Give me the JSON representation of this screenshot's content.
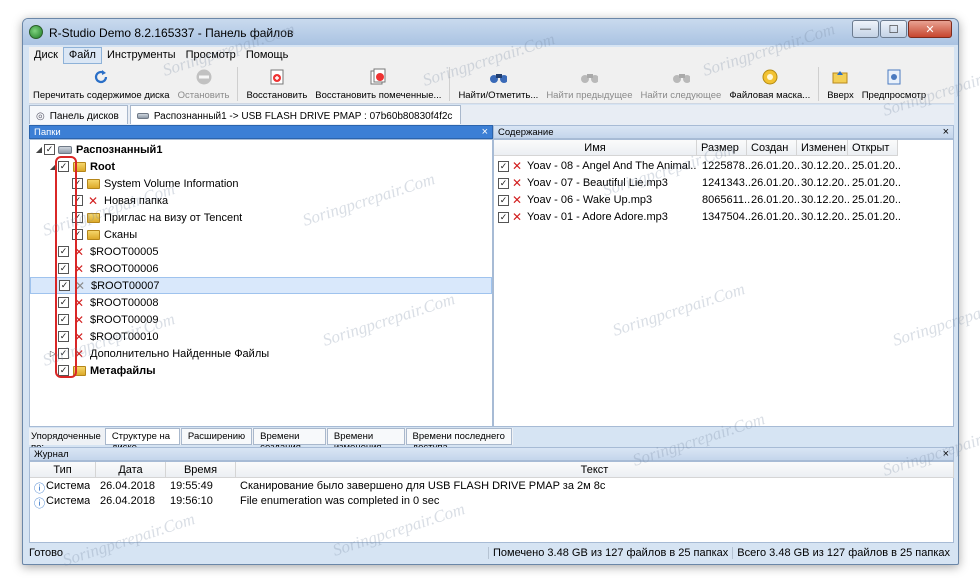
{
  "window": {
    "title": "R-Studio Demo 8.2.165337 - Панель файлов",
    "buttons": {
      "minimize": "—",
      "maximize": "☐",
      "close": "✕"
    }
  },
  "menu": [
    "Диск",
    "Файл",
    "Инструменты",
    "Просмотр",
    "Помощь"
  ],
  "toolbar": [
    {
      "label": "Перечитать содержимое диска",
      "icon": "refresh-icon",
      "enabled": true
    },
    {
      "label": "Остановить",
      "icon": "stop-icon",
      "enabled": false
    },
    {
      "label": "Восстановить",
      "icon": "recover-icon",
      "enabled": true
    },
    {
      "label": "Восстановить помеченные...",
      "icon": "recover-marked-icon",
      "enabled": true
    },
    {
      "label": "Найти/Отметить...",
      "icon": "find-icon",
      "enabled": true
    },
    {
      "label": "Найти предыдущее",
      "icon": "find-prev-icon",
      "enabled": false
    },
    {
      "label": "Найти следующее",
      "icon": "find-next-icon",
      "enabled": false
    },
    {
      "label": "Файловая маска...",
      "icon": "file-mask-icon",
      "enabled": true
    },
    {
      "label": "Вверх",
      "icon": "up-icon",
      "enabled": true
    },
    {
      "label": "Предпросмотр",
      "icon": "preview-icon",
      "enabled": true
    }
  ],
  "tabs": [
    {
      "label": "Панель дисков",
      "active": false
    },
    {
      "label": "Распознанный1 -> USB FLASH DRIVE PMAP : 07b60b80830f4f2c",
      "active": true
    }
  ],
  "folders_pane": {
    "header": "Папки",
    "close": "×",
    "tree": [
      {
        "label": "Распознанный1",
        "level": 0,
        "bold": true,
        "icon": "drive",
        "expander": "◢",
        "checked": true
      },
      {
        "label": "Root",
        "level": 1,
        "bold": true,
        "icon": "folder",
        "expander": "◢",
        "checked": true
      },
      {
        "label": "System Volume Information",
        "level": 2,
        "bold": false,
        "icon": "folder",
        "expander": "",
        "checked": true
      },
      {
        "label": "Новая папка",
        "level": 2,
        "bold": false,
        "icon": "deleted",
        "expander": "",
        "checked": true
      },
      {
        "label": "Приглас на визу от Tencent",
        "level": 2,
        "bold": false,
        "icon": "folder",
        "expander": "",
        "checked": true
      },
      {
        "label": "Сканы",
        "level": 2,
        "bold": false,
        "icon": "folder",
        "expander": "",
        "checked": true
      },
      {
        "label": "$ROOT00005",
        "level": 1,
        "bold": false,
        "icon": "deleted",
        "expander": "",
        "checked": true
      },
      {
        "label": "$ROOT00006",
        "level": 1,
        "bold": false,
        "icon": "deleted",
        "expander": "",
        "checked": true
      },
      {
        "label": "$ROOT00007",
        "level": 1,
        "bold": false,
        "icon": "deleted-gray",
        "expander": "",
        "checked": true,
        "selected": true
      },
      {
        "label": "$ROOT00008",
        "level": 1,
        "bold": false,
        "icon": "deleted",
        "expander": "",
        "checked": true
      },
      {
        "label": "$ROOT00009",
        "level": 1,
        "bold": false,
        "icon": "deleted",
        "expander": "",
        "checked": true
      },
      {
        "label": "$ROOT00010",
        "level": 1,
        "bold": false,
        "icon": "deleted",
        "expander": "",
        "checked": true
      },
      {
        "label": "Дополнительно Найденные Файлы",
        "level": 1,
        "bold": false,
        "icon": "deleted",
        "expander": "▷",
        "checked": true
      },
      {
        "label": "Метафайлы",
        "level": 1,
        "bold": true,
        "icon": "folder",
        "expander": "",
        "checked": true
      }
    ]
  },
  "contents_pane": {
    "header": "Содержание",
    "close": "×",
    "columns": [
      "Имя",
      "Размер",
      "Создан",
      "Изменен",
      "Открыт"
    ],
    "rows": [
      {
        "name": "Yoav - 08 - Angel And The Animal...",
        "size": "1225878...",
        "created": "26.01.20...",
        "modified": "30.12.20...",
        "opened": "25.01.20..."
      },
      {
        "name": "Yoav - 07 - Beautiful Lie.mp3",
        "size": "1241343...",
        "created": "26.01.20...",
        "modified": "30.12.20...",
        "opened": "25.01.20..."
      },
      {
        "name": "Yoav - 06 - Wake Up.mp3",
        "size": "8065611...",
        "created": "26.01.20...",
        "modified": "30.12.20...",
        "opened": "25.01.20..."
      },
      {
        "name": "Yoav - 01 - Adore Adore.mp3",
        "size": "1347504...",
        "created": "26.01.20...",
        "modified": "30.12.20...",
        "opened": "25.01.20..."
      }
    ]
  },
  "sortbar": {
    "label": "Упорядоченные по:",
    "tabs": [
      {
        "label": "Структуре на диске",
        "active": true
      },
      {
        "label": "Расширению",
        "active": false
      },
      {
        "label": "Времени создания",
        "active": false
      },
      {
        "label": "Времени изменения",
        "active": false
      },
      {
        "label": "Времени последнего доступа",
        "active": false
      }
    ]
  },
  "log": {
    "header": "Журнал",
    "close": "×",
    "columns": [
      "Тип",
      "Дата",
      "Время",
      "Текст"
    ],
    "rows": [
      {
        "type": "Система",
        "date": "26.04.2018",
        "time": "19:55:49",
        "text": "Сканирование было завершено для USB FLASH DRIVE PMAP за 2м 8с"
      },
      {
        "type": "Система",
        "date": "26.04.2018",
        "time": "19:56:10",
        "text": "File enumeration was completed in 0 sec"
      }
    ]
  },
  "status": {
    "left": "Готово",
    "marked": "Помечено 3.48 GB из 127 файлов в 25 папках",
    "total": "Всего 3.48 GB из 127 файлов в 25 папках"
  },
  "watermark": "Soringpcrepair.Com"
}
